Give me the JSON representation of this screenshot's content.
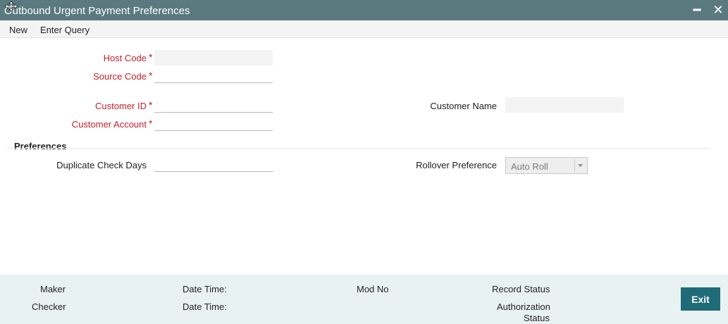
{
  "window": {
    "title": "Outbound Urgent Payment Preferences",
    "minimize_glyph": "━",
    "close_glyph": "✕"
  },
  "menu": {
    "items": [
      "New",
      "Enter Query"
    ]
  },
  "form": {
    "host_code": {
      "label": "Host Code",
      "value": ""
    },
    "source_code": {
      "label": "Source Code",
      "value": ""
    },
    "customer_id": {
      "label": "Customer ID",
      "value": ""
    },
    "customer_account": {
      "label": "Customer Account",
      "value": ""
    },
    "customer_name": {
      "label": "Customer Name",
      "value": ""
    },
    "required_mark": "*"
  },
  "preferences": {
    "title": "Preferences",
    "duplicate_check_days": {
      "label": "Duplicate Check Days",
      "value": ""
    },
    "rollover_preference": {
      "label": "Rollover Preference",
      "value": "Auto Roll"
    }
  },
  "footer": {
    "maker": "Maker",
    "checker": "Checker",
    "date_time_1": "Date Time:",
    "date_time_2": "Date Time:",
    "mod_no": "Mod No",
    "record_status": "Record Status",
    "authorization_status": "Authorization",
    "authorization_status_2": "Status",
    "exit_label": "Exit"
  },
  "colors": {
    "titlebar": "#5b7a80",
    "required": "#c2202b",
    "footer_bg": "#e9f2f3",
    "exit_button": "#1f6b78"
  },
  "icons": {
    "move": "move-arrows-icon",
    "dropdown": "chevron-down-icon"
  }
}
